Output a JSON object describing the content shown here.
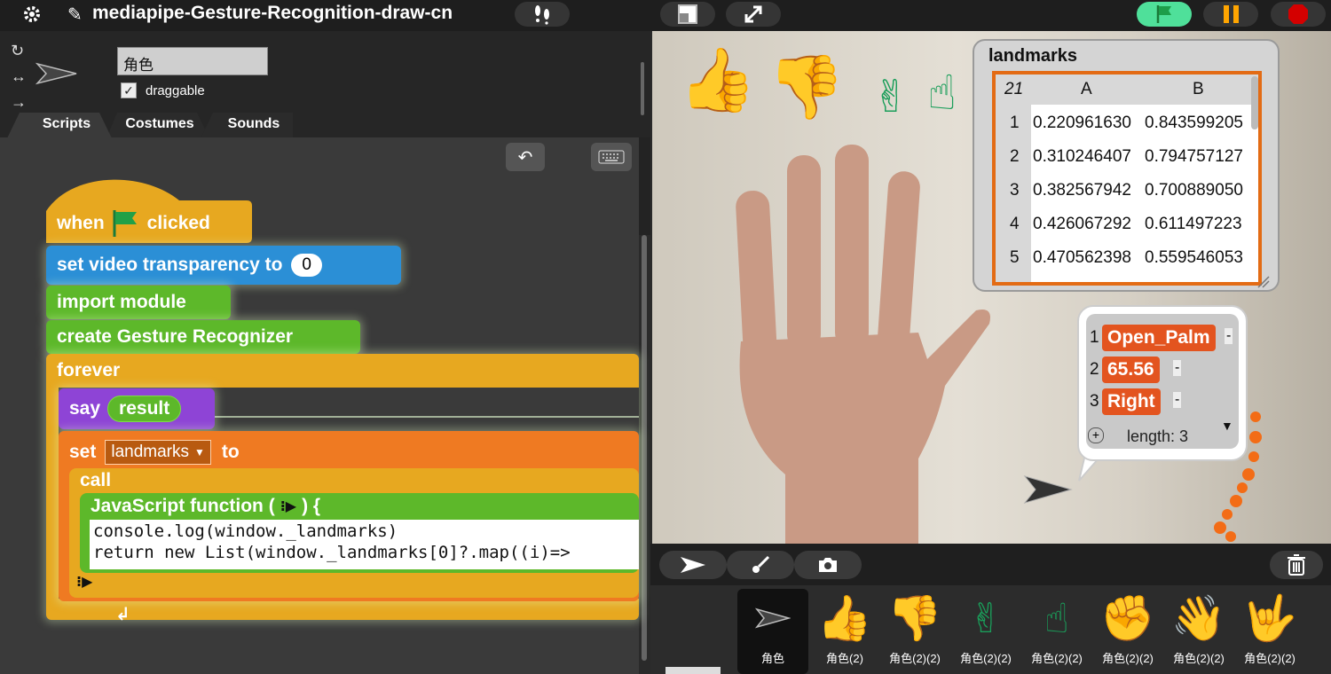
{
  "toolbar": {
    "project_title": "mediapipe-Gesture-Recognition-draw-cn",
    "colors": {
      "green_flag": "#3ddc84",
      "pause": "#ffa500",
      "stop": "#cc0000"
    }
  },
  "sprite": {
    "name": "角色",
    "draggable_label": "draggable",
    "draggable_checked": "✓"
  },
  "tabs": [
    {
      "label": "Scripts"
    },
    {
      "label": "Costumes"
    },
    {
      "label": "Sounds"
    }
  ],
  "script": {
    "hat": {
      "when": "when",
      "clicked": "clicked"
    },
    "video_transparency": {
      "label": "set video transparency to",
      "value": "0"
    },
    "import_module": "import module",
    "create_recognizer": "create Gesture Recognizer",
    "forever": "forever",
    "say": {
      "label": "say",
      "arg": "result"
    },
    "set_var": {
      "set": "set",
      "var": "landmarks",
      "to": "to"
    },
    "call": "call",
    "js_function": "JavaScript function ( ",
    "js_function_end": " ) {",
    "code_line_1": "console.log(window._landmarks)",
    "code_line_2": "return new List(window._landmarks[0]?.map((i)=>"
  },
  "watcher": {
    "title": "landmarks",
    "row_count": "21",
    "columns": [
      "A",
      "B"
    ],
    "rows": [
      {
        "index": "1",
        "A": "0.220961630",
        "B": "0.843599205"
      },
      {
        "index": "2",
        "A": "0.310246407",
        "B": "0.794757127"
      },
      {
        "index": "3",
        "A": "0.382567942",
        "B": "0.700889050"
      },
      {
        "index": "4",
        "A": "0.426067292",
        "B": "0.611497223"
      },
      {
        "index": "5",
        "A": "0.470562398",
        "B": "0.559546053"
      }
    ]
  },
  "result_list": {
    "items": [
      {
        "index": "1",
        "value": "Open_Palm"
      },
      {
        "index": "2",
        "value": "65.56"
      },
      {
        "index": "3",
        "value": "Right"
      }
    ],
    "length_label": "length: 3",
    "add_symbol": "+",
    "remove_symbol": "-"
  },
  "stage_tools": {
    "trash_icon": "trash-icon"
  },
  "sprites": [
    {
      "icon": "arrow",
      "label": "角色",
      "selected": true
    },
    {
      "icon": "👍",
      "label": "角色(2)"
    },
    {
      "icon": "👎",
      "label": "角色(2)(2)"
    },
    {
      "icon": "✌",
      "label": "角色(2)(2)"
    },
    {
      "icon": "☝",
      "label": "角色(2)(2)"
    },
    {
      "icon": "✊",
      "label": "角色(2)(2)"
    },
    {
      "icon": "👋",
      "label": "角色(2)(2)"
    },
    {
      "icon": "🤟",
      "label": "角色(2)(2)"
    }
  ]
}
